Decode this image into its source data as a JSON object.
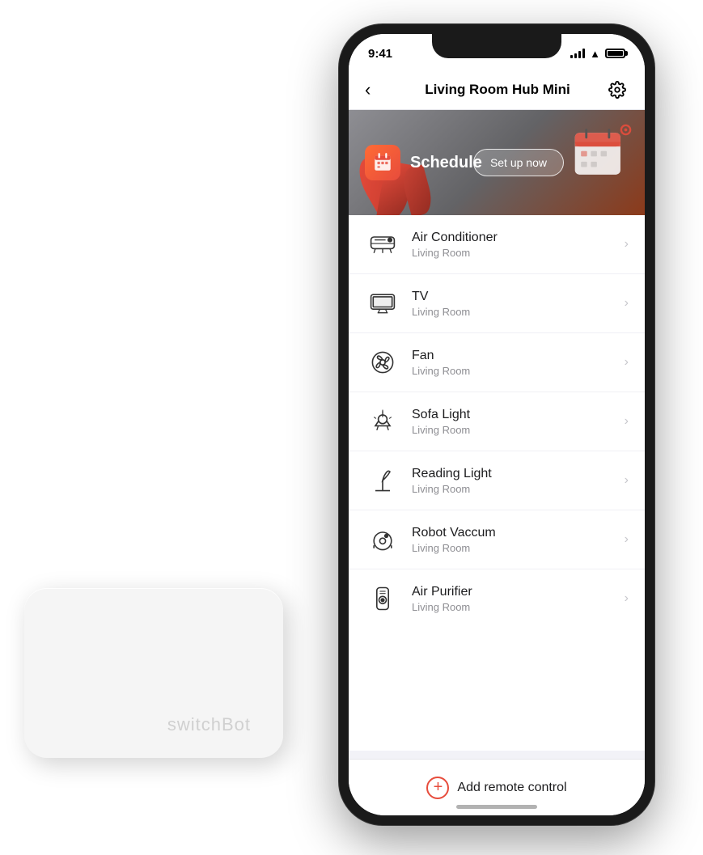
{
  "page": {
    "background": "#ffffff"
  },
  "hardware": {
    "brand": "switchBot"
  },
  "phone": {
    "status_bar": {
      "time": "9:41"
    },
    "nav": {
      "back_label": "‹",
      "title": "Living Room Hub Mini",
      "settings_label": "⚙"
    },
    "schedule_card": {
      "icon": "📅",
      "label": "Schedule",
      "button_label": "Set up now"
    },
    "devices": [
      {
        "name": "Air Conditioner",
        "room": "Living Room",
        "icon": "ac"
      },
      {
        "name": "TV",
        "room": "Living Room",
        "icon": "tv"
      },
      {
        "name": "Fan",
        "room": "Living Room",
        "icon": "fan"
      },
      {
        "name": "Sofa Light",
        "room": "Living Room",
        "icon": "lamp"
      },
      {
        "name": "Reading Light",
        "room": "Living Room",
        "icon": "reading-light"
      },
      {
        "name": "Robot Vaccum",
        "room": "Living Room",
        "icon": "robot"
      },
      {
        "name": "Air Purifier",
        "room": "Living Room",
        "icon": "purifier"
      }
    ],
    "add_remote": {
      "label": "Add remote control"
    }
  }
}
